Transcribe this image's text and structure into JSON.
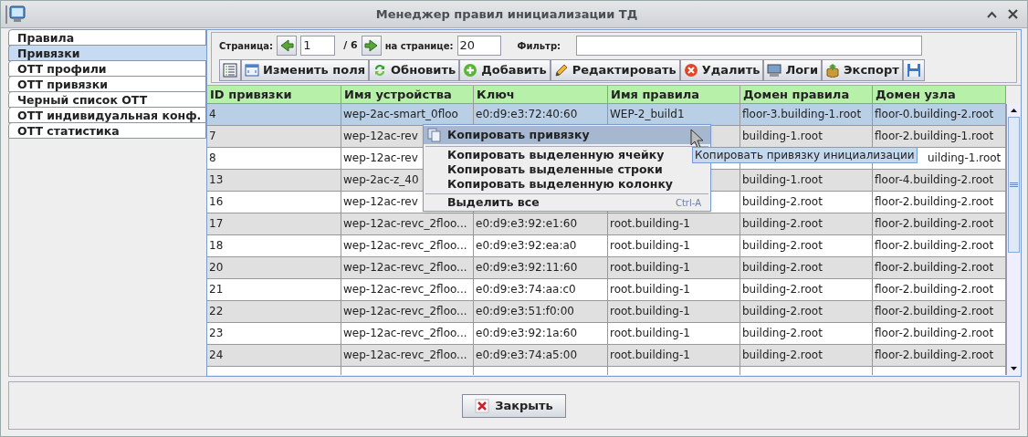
{
  "window": {
    "title": "Менеджер правил инициализации ТД"
  },
  "sidebar": {
    "items": [
      {
        "label": "Правила",
        "selected": false
      },
      {
        "label": "Привязки",
        "selected": true
      },
      {
        "label": "OTT профили",
        "selected": false
      },
      {
        "label": "OTT привязки",
        "selected": false
      },
      {
        "label": "Черный список OTT",
        "selected": false
      },
      {
        "label": "OTT индивидуальная конф.",
        "selected": false
      },
      {
        "label": "OTT статистика",
        "selected": false
      }
    ]
  },
  "pager": {
    "page_label": "Страница:",
    "page": "1",
    "of": "/ 6",
    "per_page_label": "на странице:",
    "per_page": "20",
    "filter_label": "Фильтр:"
  },
  "toolbar": {
    "buttons": [
      {
        "kind": "columns"
      },
      {
        "kind": "fields",
        "label": "Изменить поля"
      },
      {
        "kind": "refresh",
        "label": "Обновить"
      },
      {
        "kind": "add",
        "label": "Добавить"
      },
      {
        "kind": "edit",
        "label": "Редактировать"
      },
      {
        "kind": "delete",
        "label": "Удалить"
      },
      {
        "kind": "logs",
        "label": "Логи"
      },
      {
        "kind": "export",
        "label": "Экспорт"
      },
      {
        "kind": "save"
      }
    ]
  },
  "table": {
    "columns": [
      "ID привязки",
      "Имя устройства",
      "Ключ",
      "Имя правила",
      "Домен правила",
      "Домен узла"
    ],
    "rows": [
      {
        "selected": true,
        "cells": [
          "4",
          "wep-2ac-smart_0floo",
          "e0:d9:e3:72:40:60",
          "WEP-2_build1",
          "floor-3.building-1.root",
          "floor-0.building-2.root"
        ]
      },
      {
        "selected": false,
        "cells": [
          "7",
          "wep-12ac-rev",
          null,
          null,
          "building-1.root",
          "floor-2.building-1.root"
        ]
      },
      {
        "selected": false,
        "cells": [
          "8",
          "wep-12ac-rev",
          null,
          null,
          null,
          "uilding-1.root"
        ]
      },
      {
        "selected": false,
        "cells": [
          "13",
          "wep-2ac-z_40",
          null,
          null,
          "building-1.root",
          "floor-4.building-2.root"
        ]
      },
      {
        "selected": false,
        "cells": [
          "16",
          "wep-12ac-rev",
          null,
          null,
          "building-2.root",
          "floor-2.building-2.root"
        ]
      },
      {
        "selected": false,
        "cells": [
          "17",
          "wep-12ac-revc_2floo...",
          "e0:d9:e3:92:e1:60",
          "root.building-1",
          "building-2.root",
          "floor-2.building-2.root"
        ]
      },
      {
        "selected": false,
        "cells": [
          "18",
          "wep-12ac-revc_2floo...",
          "e0:d9:e3:92:ea:a0",
          "root.building-1",
          "building-2.root",
          "floor-2.building-2.root"
        ]
      },
      {
        "selected": false,
        "cells": [
          "20",
          "wep-12ac-revc_2floo...",
          "e0:d9:e3:92:11:60",
          "root.building-1",
          "building-2.root",
          "floor-2.building-2.root"
        ]
      },
      {
        "selected": false,
        "cells": [
          "21",
          "wep-12ac-revc_2floo...",
          "e0:d9:e3:74:aa:c0",
          "root.building-1",
          "building-2.root",
          "floor-2.building-2.root"
        ]
      },
      {
        "selected": false,
        "cells": [
          "22",
          "wep-12ac-revc_2floo...",
          "e0:d9:e3:51:f0:00",
          "root.building-1",
          "building-2.root",
          "floor-2.building-2.root"
        ]
      },
      {
        "selected": false,
        "cells": [
          "23",
          "wep-12ac-revc_2floo...",
          "e0:d9:e3:92:1a:60",
          "root.building-1",
          "building-2.root",
          "floor-2.building-2.root"
        ]
      },
      {
        "selected": false,
        "cells": [
          "24",
          "wep-12ac-revc_2floo...",
          "e0:d9:e3:74:a5:00",
          "root.building-1",
          "building-2.root",
          "floor-2.building-2.root"
        ]
      }
    ]
  },
  "context_menu": {
    "items": [
      {
        "kind": "item",
        "label": "Копировать привязку",
        "highlighted": true
      },
      {
        "kind": "separator"
      },
      {
        "kind": "item",
        "label": "Копировать выделенную ячейку",
        "highlighted": false
      },
      {
        "kind": "item",
        "label": "Копировать выделенные строки",
        "highlighted": false
      },
      {
        "kind": "item",
        "label": "Копировать выделенную колонку",
        "highlighted": false
      },
      {
        "kind": "separator"
      },
      {
        "kind": "item",
        "label": "Выделить все",
        "shortcut": "Ctrl-A",
        "highlighted": false
      }
    ]
  },
  "tooltip": "Копировать привязку инициализации",
  "close_button": "Закрыть"
}
